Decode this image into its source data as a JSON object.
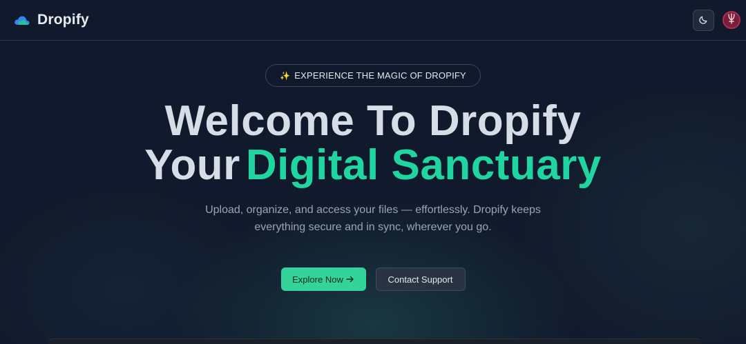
{
  "brand": {
    "name": "Dropify",
    "icon": "cloud-icon"
  },
  "nav": {
    "theme_icon": "moon-icon",
    "avatar_icon": "avatar-emblem"
  },
  "hero": {
    "badge_icon": "✨",
    "badge_text": "EXPERIENCE THE MAGIC OF DROPIFY",
    "title_line1": "Welcome To Dropify",
    "title_line2_plain": "Your",
    "title_line2_accent": "Digital Sanctuary",
    "subtitle": "Upload, organize, and access your files — effortlessly. Dropify keeps everything secure and in sync, wherever you go.",
    "primary_cta": "Explore Now",
    "primary_cta_icon": "arrow-right-icon",
    "secondary_cta": "Contact Support"
  },
  "colors": {
    "background": "#111a2c",
    "accent": "#20d6a0",
    "primary_button": "#34d399",
    "avatar": "#7a1e3c"
  }
}
